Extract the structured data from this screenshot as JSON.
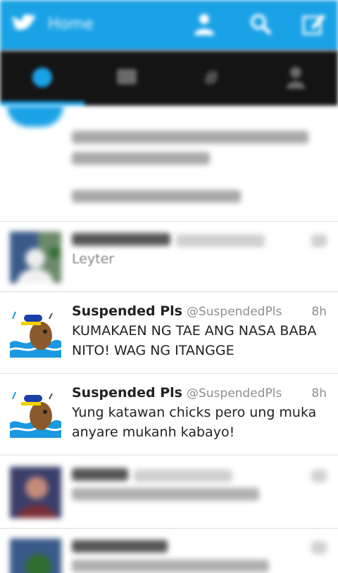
{
  "app": {
    "title": "Home"
  },
  "colors": {
    "accent": "#1aa2e6",
    "tabbar": "#141414"
  },
  "icons": {
    "logo": "twitter-bird-icon",
    "actions": [
      "person-add-icon",
      "search-icon",
      "compose-icon"
    ],
    "tabs": [
      "home-icon",
      "mentions-icon",
      "discover-icon",
      "me-icon"
    ]
  },
  "tweets": [
    {
      "name": "",
      "handle": "",
      "time": "",
      "text": "Leyter"
    },
    {
      "name": "Suspended Pls",
      "handle": "@SuspendedPls",
      "time": "8h",
      "text": "KUMAKAEN NG TAE ANG NASA BABA NITO! WAG NG ITANGGE"
    },
    {
      "name": "Suspended Pls",
      "handle": "@SuspendedPls",
      "time": "8h",
      "text": "Yung katawan chicks pero ung muka anyare mukanh kabayo!"
    }
  ]
}
